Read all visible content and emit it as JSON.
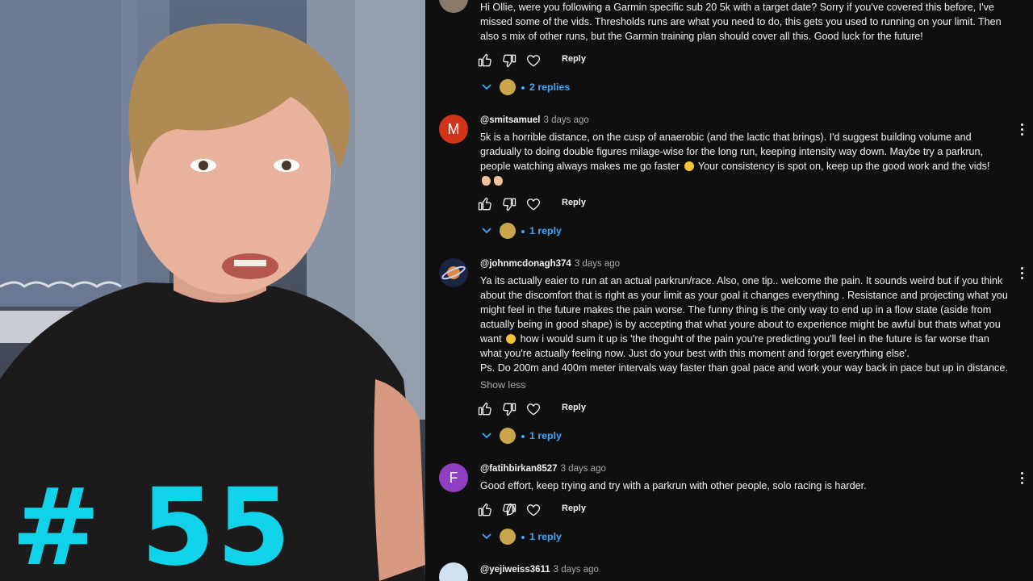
{
  "video": {
    "episode_label": "# 55"
  },
  "comments": [
    {
      "handle": "",
      "time": "",
      "avatar_letter": "",
      "avatar_color": "#8a7a6a",
      "paragraphs": [
        "Hi Ollie, were you following a Garmin specific sub 20 5k with a target date? Sorry if you've covered this before, I've missed some of the vids. Thresholds runs are what you need to do, this gets you used to running on your limit. Then also s mix of other runs, but the Garmin training plan should cover all this. Good luck for the future!"
      ],
      "reply_label": "Reply",
      "replies_label": "2 replies"
    },
    {
      "handle": "@smitsamuel",
      "time": "3 days ago",
      "avatar_letter": "M",
      "avatar_color": "#d2341b",
      "paragraphs": [
        "5k is a horrible distance, on the cusp of anaerobic (and the lactic that brings). I'd suggest building volume and gradually to doing double figures milage-wise for the long run, keeping intensity way down. Maybe try a parkrun, people watching always makes me go faster",
        "Your consistency is spot on, keep up the good work and the vids!"
      ],
      "reply_label": "Reply",
      "replies_label": "1 reply"
    },
    {
      "handle": "@johnmcdonagh374",
      "time": "3 days ago",
      "avatar_letter": "",
      "avatar_color": "#1b2440",
      "paragraphs": [
        "Ya its actually eaier to run at an actual parkrun/race. Also, one tip.. welcome the pain. It sounds weird but if you think about the discomfort that is right as your limit as your goal it changes everything . Resistance and projecting what you might feel in the future makes the pain worse. The funny thing is the only way to end up in a flow state (aside from actually being in good shape) is by accepting that what youre about to experience might be awful but thats what you want",
        "how i would sum it up is 'the thoguht of the pain you're predicting you'll feel in the future is far worse than what you're actually feeling now. Just do your best with this moment and forget everything else'.",
        "Ps. Do 200m and 400m meter intervals way faster than goal pace and work your way back in pace but up in distance."
      ],
      "show_less": "Show less",
      "reply_label": "Reply",
      "replies_label": "1 reply"
    },
    {
      "handle": "@fatihbirkan8527",
      "time": "3 days ago",
      "avatar_letter": "F",
      "avatar_color": "#8e3fc4",
      "paragraphs": [
        "Good effort, keep trying and try with a parkrun with other people, solo racing is harder."
      ],
      "reply_label": "Reply",
      "replies_label": "1 reply"
    },
    {
      "handle": "@yejiweiss3611",
      "time": "3 days ago",
      "avatar_letter": "",
      "avatar_color": "#cfe0f0"
    }
  ],
  "icons": [
    "like-icon",
    "dislike-icon",
    "heart-icon",
    "chevron-down-icon",
    "more-vertical-icon"
  ],
  "colors": {
    "accent_link": "#3ea6ff",
    "episode_number": "#10d2e8",
    "panel_bg": "#0f0f0f"
  }
}
